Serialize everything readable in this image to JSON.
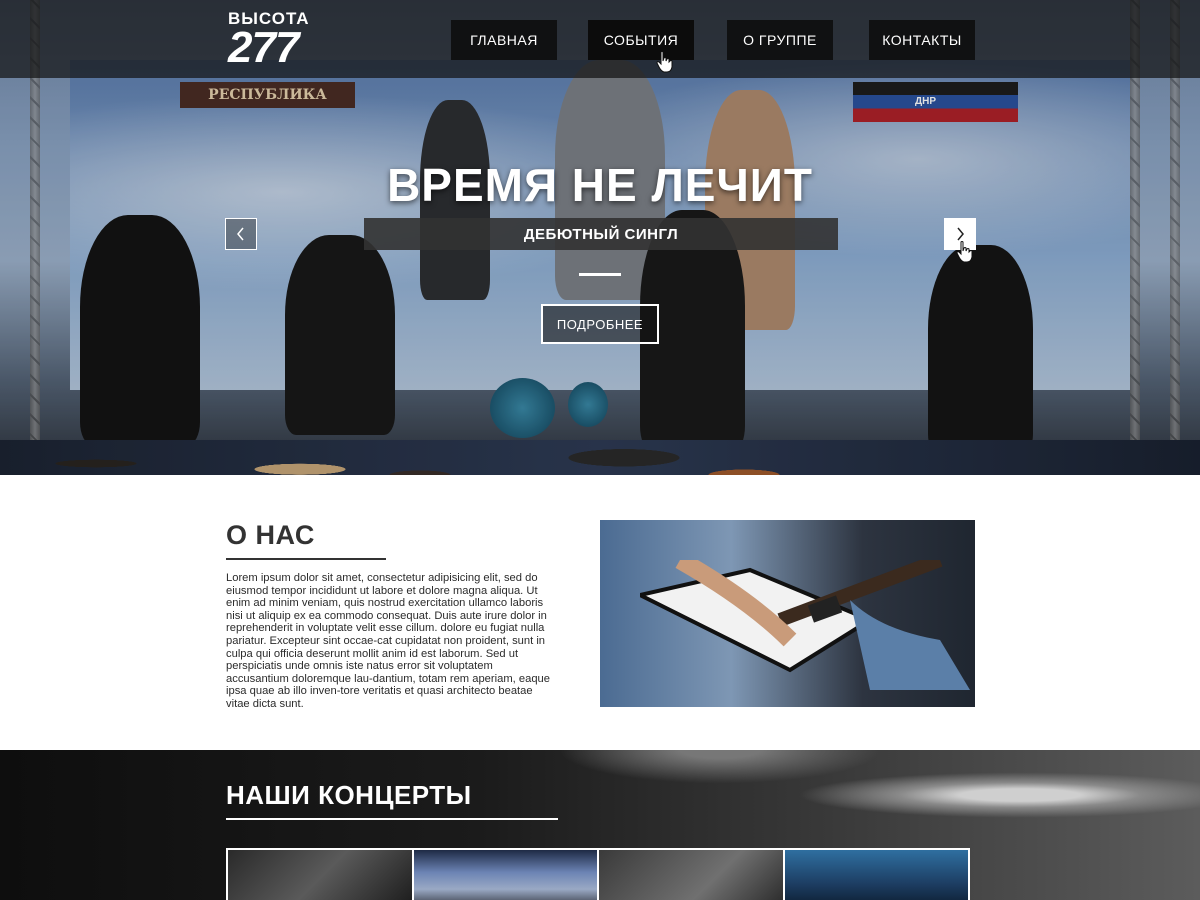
{
  "logo": {
    "line1": "ВЫСОТА",
    "line2": "277"
  },
  "nav": {
    "items": [
      {
        "label": "ГЛАВНАЯ"
      },
      {
        "label": "СОБЫТИЯ"
      },
      {
        "label": "О ГРУППЕ"
      },
      {
        "label": "КОНТАКТЫ"
      }
    ],
    "hovered": "СОБЫТИЯ"
  },
  "hero": {
    "title": "ВРЕМЯ НЕ ЛЕЧИТ",
    "subtitle": "ДЕБЮТНЫЙ СИНГЛ",
    "button": "ПОДРОБНЕЕ",
    "banner_left_text": "РЕСПУБЛИКА",
    "banner_right_text": "ДНР",
    "prev_icon": "chevron-left-icon",
    "next_icon": "chevron-right-icon"
  },
  "about": {
    "title": "О НАС",
    "text": "Lorem ipsum dolor sit amet, consectetur adipisicing elit, sed do eiusmod tempor incididunt ut labore et dolore magna aliqua. Ut enim ad minim veniam, quis nostrud exercitation ullamco laboris nisi ut aliquip ex ea commodo consequat. Duis aute irure dolor in reprehenderit in voluptate velit esse cillum. dolore eu fugiat nulla pariatur. Excepteur sint occae-cat cupidatat non proident, sunt in culpa qui officia deserunt mollit anim id est laborum. Sed ut perspiciatis unde omnis iste natus error sit voluptatem accusantium doloremque lau-dantium, totam rem aperiam, eaque ipsa quae ab illo inven-tore veritatis et quasi architecto beatae vitae dicta sunt."
  },
  "concerts": {
    "title": "НАШИ КОНЦЕРТЫ",
    "thumbnails": [
      "concert-photo-1",
      "concert-photo-2",
      "concert-photo-3",
      "concert-photo-4"
    ]
  },
  "colors": {
    "nav_bg": "#141414",
    "text_dark": "#333333",
    "white": "#ffffff"
  }
}
